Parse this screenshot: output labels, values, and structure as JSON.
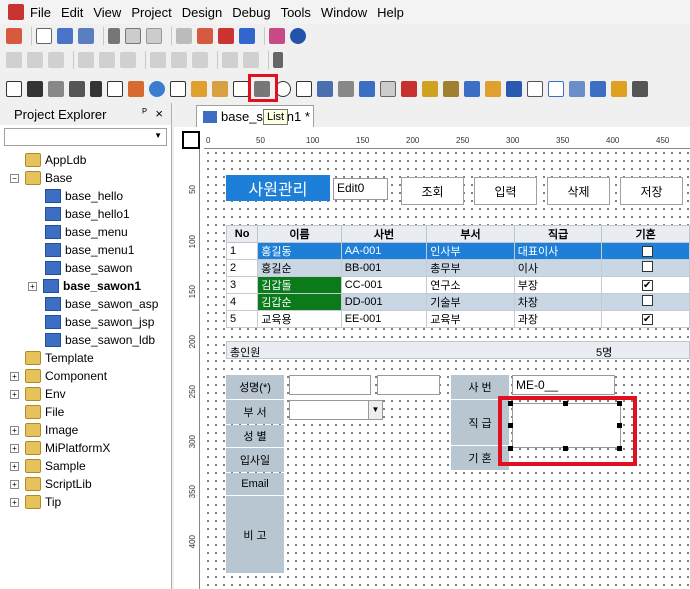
{
  "menubar": {
    "items": [
      "File",
      "Edit",
      "View",
      "Project",
      "Design",
      "Debug",
      "Tools",
      "Window",
      "Help"
    ]
  },
  "tooltip": {
    "text": "List"
  },
  "project_explorer": {
    "title": "Project Explorer",
    "pin": "ᴾ",
    "close": "×",
    "tree": [
      {
        "label": "AppLdb",
        "level": 1,
        "icon": "folder",
        "expander": ""
      },
      {
        "label": "Base",
        "level": 0,
        "icon": "folder",
        "expander": "−"
      },
      {
        "label": "base_hello",
        "level": 2,
        "icon": "form",
        "expander": ""
      },
      {
        "label": "base_hello1",
        "level": 2,
        "icon": "form",
        "expander": ""
      },
      {
        "label": "base_menu",
        "level": 2,
        "icon": "form",
        "expander": ""
      },
      {
        "label": "base_menu1",
        "level": 2,
        "icon": "form",
        "expander": ""
      },
      {
        "label": "base_sawon",
        "level": 2,
        "icon": "form",
        "expander": ""
      },
      {
        "label": "base_sawon1",
        "level": 2,
        "icon": "form",
        "expander": "+",
        "bold": true
      },
      {
        "label": "base_sawon_asp",
        "level": 2,
        "icon": "form",
        "expander": ""
      },
      {
        "label": "base_sawon_jsp",
        "level": 2,
        "icon": "form",
        "expander": ""
      },
      {
        "label": "base_sawon_ldb",
        "level": 2,
        "icon": "form",
        "expander": ""
      },
      {
        "label": "Template",
        "level": 1,
        "icon": "folder",
        "expander": ""
      },
      {
        "label": "Component",
        "level": 0,
        "icon": "folder",
        "expander": "+"
      },
      {
        "label": "Env",
        "level": 0,
        "icon": "folder",
        "expander": "+"
      },
      {
        "label": "File",
        "level": 1,
        "icon": "folder",
        "expander": ""
      },
      {
        "label": "Image",
        "level": 0,
        "icon": "folder",
        "expander": "+"
      },
      {
        "label": "MiPlatformX",
        "level": 0,
        "icon": "folder",
        "expander": "+"
      },
      {
        "label": "Sample",
        "level": 0,
        "icon": "folder",
        "expander": "+"
      },
      {
        "label": "ScriptLib",
        "level": 0,
        "icon": "folder",
        "expander": "+"
      },
      {
        "label": "Tip",
        "level": 0,
        "icon": "folder",
        "expander": "+"
      }
    ]
  },
  "tab": {
    "label": "base_sawon1 *"
  },
  "ruler": {
    "h": [
      "0",
      "50",
      "100",
      "150",
      "200",
      "250",
      "300",
      "350",
      "400",
      "450"
    ],
    "v": [
      "50",
      "100",
      "150",
      "200",
      "250",
      "300",
      "350",
      "400"
    ]
  },
  "form": {
    "title": "사원관리",
    "edit0": "Edit0",
    "buttons": [
      "조회",
      "입력",
      "삭제",
      "저장"
    ],
    "grid": {
      "headers": [
        "No",
        "이름",
        "사번",
        "부서",
        "직급",
        "기혼"
      ],
      "rows": [
        {
          "no": "1",
          "name": "홍길동",
          "id": "AA-001",
          "dept": "인사부",
          "rank": "대표이사",
          "married": true,
          "style": "selected"
        },
        {
          "no": "2",
          "name": "홍길순",
          "id": "BB-001",
          "dept": "총무부",
          "rank": "이사",
          "married": false,
          "style": "alt"
        },
        {
          "no": "3",
          "name": "김갑돌",
          "id": "CC-001",
          "dept": "연구소",
          "rank": "부장",
          "married": true,
          "style": "green"
        },
        {
          "no": "4",
          "name": "김갑순",
          "id": "DD-001",
          "dept": "기술부",
          "rank": "차장",
          "married": false,
          "style": "green-alt"
        },
        {
          "no": "5",
          "name": "교육용",
          "id": "EE-001",
          "dept": "교육부",
          "rank": "과장",
          "married": true,
          "style": "plain"
        }
      ],
      "footer_label": "총인원",
      "footer_count": "5명"
    },
    "labels": {
      "name": "성명(*)",
      "dept": "부 서",
      "gender": "성 별",
      "joined": "입사일",
      "email": "Email",
      "note": "비 고",
      "id": "사 번",
      "rank": "직 급",
      "married": "기 혼"
    },
    "id_value": "ME-0__"
  },
  "colors": {
    "selected": "#1e7fd8",
    "alt": "#c9d6e3",
    "green": "#0a7a1a",
    "label_bg": "#b8c6d2",
    "highlight": "#e01020"
  }
}
